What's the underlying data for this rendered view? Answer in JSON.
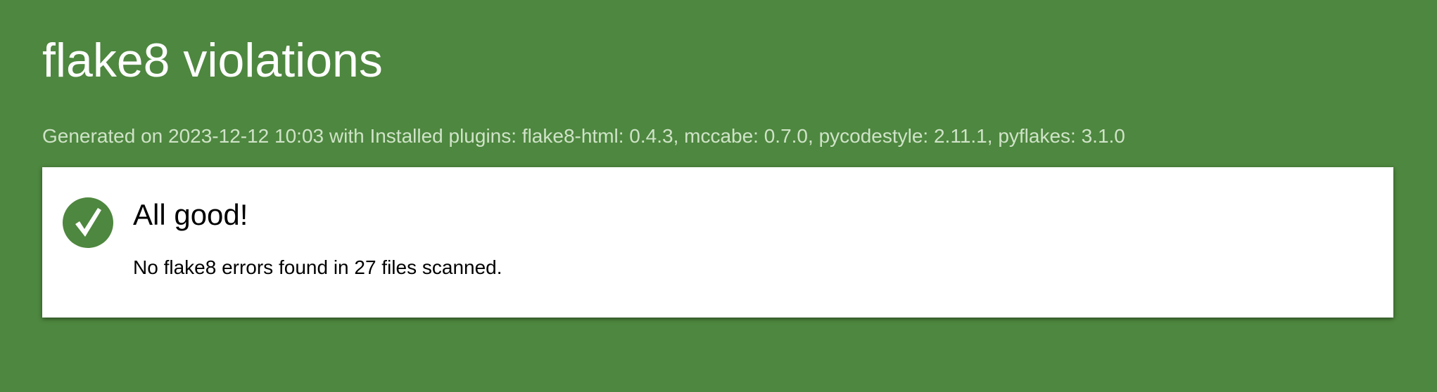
{
  "page": {
    "title": "flake8 violations",
    "generated_line": "Generated on 2023-12-12 10:03 with Installed plugins: flake8-html: 0.4.3, mccabe: 0.7.0, pycodestyle: 2.11.1, pyflakes: 3.1.0"
  },
  "result": {
    "icon": "check-circle-icon",
    "heading": "All good!",
    "message": "No flake8 errors found in 27 files scanned."
  },
  "colors": {
    "background": "#4e873f",
    "card": "#ffffff",
    "accent": "#4e873f"
  }
}
